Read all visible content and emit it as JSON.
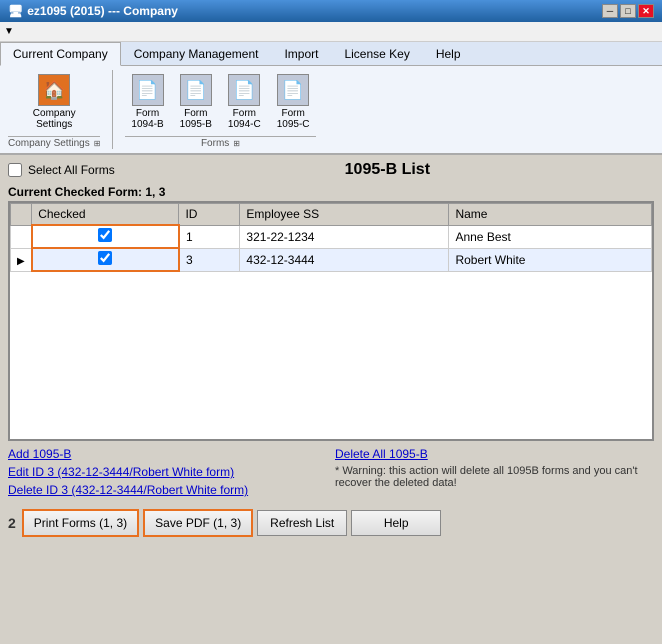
{
  "window": {
    "title": "ez1095 (2015) --- Company",
    "min_label": "─",
    "max_label": "□",
    "close_label": "✕"
  },
  "ribbon": {
    "tabs": [
      {
        "id": "current-company",
        "label": "Current Company",
        "active": true
      },
      {
        "id": "company-management",
        "label": "Company Management",
        "active": false
      },
      {
        "id": "import",
        "label": "Import",
        "active": false
      },
      {
        "id": "license-key",
        "label": "License Key",
        "active": false
      },
      {
        "id": "help",
        "label": "Help",
        "active": false
      }
    ],
    "groups": [
      {
        "id": "company-settings-group",
        "items": [
          {
            "id": "company-settings",
            "icon": "🏠",
            "label": "Company\nSettings",
            "type": "home"
          }
        ],
        "label": "Company Settings",
        "expand": "⊞"
      },
      {
        "id": "forms-group",
        "items": [
          {
            "id": "form-1094b",
            "icon": "📄",
            "label": "Form\n1094-B"
          },
          {
            "id": "form-1095b",
            "icon": "📄",
            "label": "Form\n1095-B"
          },
          {
            "id": "form-1094c",
            "icon": "📄",
            "label": "Form\n1094-C"
          },
          {
            "id": "form-1095c",
            "icon": "📄",
            "label": "Form\n1095-C"
          }
        ],
        "label": "Forms",
        "expand": "⊞"
      }
    ]
  },
  "main": {
    "select_all_label": "Select All Forms",
    "page_title": "1095-B List",
    "checked_form_label": "Current Checked Form: 1, 3",
    "table": {
      "columns": [
        "",
        "Checked",
        "ID",
        "Employee SS",
        "Name"
      ],
      "rows": [
        {
          "indicator": "",
          "checked": true,
          "id": "1",
          "ss": "321-22-1234",
          "name": "Anne Best"
        },
        {
          "indicator": "▶",
          "checked": true,
          "id": "3",
          "ss": "432-12-3444",
          "name": "Robert White"
        }
      ]
    }
  },
  "bottom": {
    "link_add": "Add 1095-B",
    "link_edit": "Edit ID 3 (432-12-3444/Robert White form)",
    "link_delete_id": "Delete ID 3 (432-12-3444/Robert White form)",
    "link_delete_all": "Delete All 1095-B",
    "warning_text": "* Warning: this action will delete all 1095B forms and you can't recover the deleted data!"
  },
  "buttons": {
    "step2_label": "2",
    "print_forms": "Print Forms (1, 3)",
    "save_pdf": "Save PDF (1, 3)",
    "refresh_list": "Refresh List",
    "help": "Help"
  }
}
